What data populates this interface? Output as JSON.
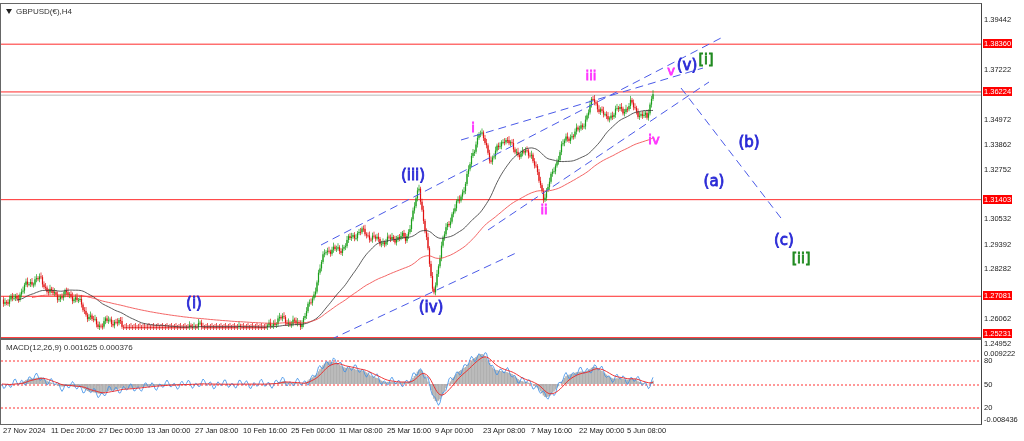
{
  "chart": {
    "title": "GBPUSD(€),H4"
  },
  "price_axis": [
    {
      "label": "1.39442",
      "kind": "tick"
    },
    {
      "label": "1.38360",
      "kind": "level"
    },
    {
      "label": "1.37222",
      "kind": "tick"
    },
    {
      "label": "1.36224",
      "kind": "level"
    },
    {
      "label": "1.34972",
      "kind": "tick"
    },
    {
      "label": "1.33862",
      "kind": "tick"
    },
    {
      "label": "1.32752",
      "kind": "tick"
    },
    {
      "label": "1.31403",
      "kind": "level"
    },
    {
      "label": "1.30532",
      "kind": "tick"
    },
    {
      "label": "1.29392",
      "kind": "tick"
    },
    {
      "label": "1.28282",
      "kind": "tick"
    },
    {
      "label": "1.27081",
      "kind": "level"
    },
    {
      "label": "1.26062",
      "kind": "tick"
    },
    {
      "label": "1.25231",
      "kind": "level"
    },
    {
      "label": "1.24952",
      "kind": "tick"
    }
  ],
  "wave_labels": [
    {
      "text": "(i)",
      "color": "#2b2bd6"
    },
    {
      "text": "(iii)",
      "color": "#2b2bd6"
    },
    {
      "text": "(iv)",
      "color": "#2b2bd6"
    },
    {
      "text": "i",
      "color": "#ff33ff"
    },
    {
      "text": "ii",
      "color": "#ff33ff"
    },
    {
      "text": "iii",
      "color": "#ff33ff"
    },
    {
      "text": "iv",
      "color": "#ff33ff"
    },
    {
      "text": "v",
      "color": "#ff33ff"
    },
    {
      "text": "(v)",
      "color": "#2b2bd6"
    },
    {
      "text": "[i]",
      "color": "#228b22"
    },
    {
      "text": "(a)",
      "color": "#2b2bd6"
    },
    {
      "text": "(b)",
      "color": "#2b2bd6"
    },
    {
      "text": "(c)",
      "color": "#2b2bd6"
    },
    {
      "text": "[ii]",
      "color": "#228b22"
    }
  ],
  "macd": {
    "title": "MACD(12,26,9) 0.001625 0.000376",
    "axis": [
      {
        "label": "0.009222",
        "kind": "tick"
      },
      {
        "label": "80",
        "kind": "level"
      },
      {
        "label": "50",
        "kind": "level"
      },
      {
        "label": "20",
        "kind": "level"
      },
      {
        "label": "-0.008436",
        "kind": "tick"
      }
    ]
  },
  "time_axis": [
    "27 Nov 2024",
    "11 Dec 20:00",
    "27 Dec 00:00",
    "13 Jan 00:00",
    "27 Jan 08:00",
    "10 Feb 16:00",
    "25 Feb 00:00",
    "11 Mar 08:00",
    "25 Mar 16:00",
    "9 Apr 00:00",
    "23 Apr 08:00",
    "7 May 16:00",
    "22 May 00:00",
    "5 Jun 08:00"
  ]
}
